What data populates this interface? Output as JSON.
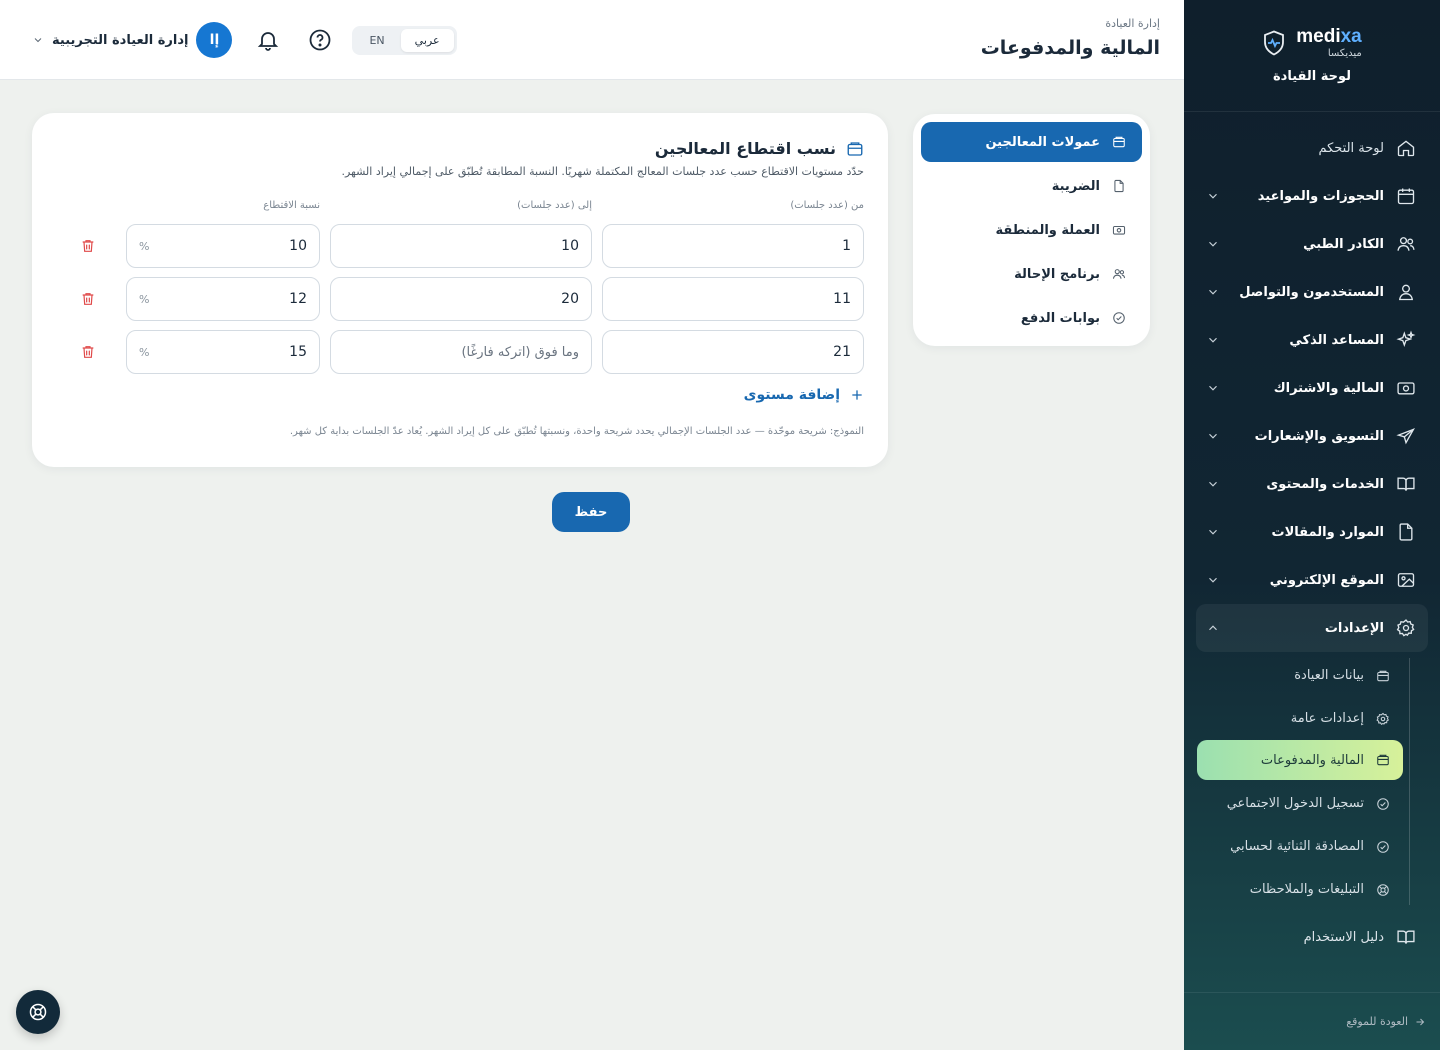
{
  "brand": {
    "name_en_part1": "medi",
    "name_en_part2": "xa",
    "name_ar": "ميديكسا",
    "dashboard_title": "لوحة القيادة"
  },
  "header": {
    "breadcrumb": "إدارة العيادة",
    "title": "المالية والمدفوعات",
    "user_name": "إدارة العيادة التجريبية",
    "avatar_initial": "إا",
    "lang_ar": "عربي",
    "lang_en": "EN"
  },
  "sidebar": {
    "items": [
      {
        "label": "لوحة التحكم",
        "icon": "home-icon"
      },
      {
        "label": "الحجوزات والمواعيد",
        "icon": "calendar-icon"
      },
      {
        "label": "الكادر الطبي",
        "icon": "users-icon"
      },
      {
        "label": "المستخدمون والتواصل",
        "icon": "user-icon"
      },
      {
        "label": "المساعد الذكي",
        "icon": "sparkles-icon"
      },
      {
        "label": "المالية والاشتراك",
        "icon": "banknote-icon"
      },
      {
        "label": "التسويق والإشعارات",
        "icon": "send-icon"
      },
      {
        "label": "الخدمات والمحتوى",
        "icon": "book-open-icon"
      },
      {
        "label": "الموارد والمقالات",
        "icon": "file-icon"
      },
      {
        "label": "الموقع الإلكتروني",
        "icon": "image-icon"
      },
      {
        "label": "الإعدادات",
        "icon": "gear-icon"
      }
    ],
    "settings_sub": [
      {
        "label": "بيانات العيادة",
        "icon": "wallet-icon"
      },
      {
        "label": "إعدادات عامة",
        "icon": "gear-icon"
      },
      {
        "label": "المالية والمدفوعات",
        "icon": "wallet-icon",
        "active": true
      },
      {
        "label": "تسجيل الدخول الاجتماعي",
        "icon": "check-circle-icon"
      },
      {
        "label": "المصادقة الثنائية لحسابي",
        "icon": "check-circle-icon"
      },
      {
        "label": "التبليغات والملاحظات",
        "icon": "lifebuoy-icon"
      }
    ],
    "guide": "دليل الاستخدام",
    "back_to_site": "العودة للموقع"
  },
  "tabs": [
    {
      "label": "عمولات المعالجين",
      "icon": "wallet-icon",
      "active": true
    },
    {
      "label": "الضريبة",
      "icon": "file-icon"
    },
    {
      "label": "العملة والمنطقة",
      "icon": "banknote-icon"
    },
    {
      "label": "برنامج الإحالة",
      "icon": "users-icon"
    },
    {
      "label": "بوابات الدفع",
      "icon": "check-circle-icon"
    }
  ],
  "commission": {
    "title": "نسب اقتطاع المعالجين",
    "description": "حدّد مستويات الاقتطاع حسب عدد جلسات المعالج المكتملة شهريًا. النسبة المطابقة تُطبّق على إجمالي إيراد الشهر.",
    "col_from": "من (عدد جلسات)",
    "col_to": "إلى (عدد جلسات)",
    "col_pct": "نسبة الاقتطاع",
    "percent_sign": "%",
    "to_placeholder": "وما فوق (اتركه فارغًا)",
    "rows": [
      {
        "from": "1",
        "to": "10",
        "pct": "10"
      },
      {
        "from": "11",
        "to": "20",
        "pct": "12"
      },
      {
        "from": "21",
        "to": "",
        "pct": "15"
      }
    ],
    "add_level": "إضافة مستوى",
    "note": "النموذج: شريحة موحّدة — عدد الجلسات الإجمالي يحدد شريحة واحدة، ونسبتها تُطبّق على كل إيراد الشهر. يُعاد عدّ الجلسات بداية كل شهر."
  },
  "save_label": "حفظ",
  "colors": {
    "primary": "#1868b0",
    "sidebar_bg": "#0f1f2c",
    "active_sub_start": "#9be0b0",
    "active_sub_end": "#d7f19a",
    "danger": "#e04a4a"
  }
}
